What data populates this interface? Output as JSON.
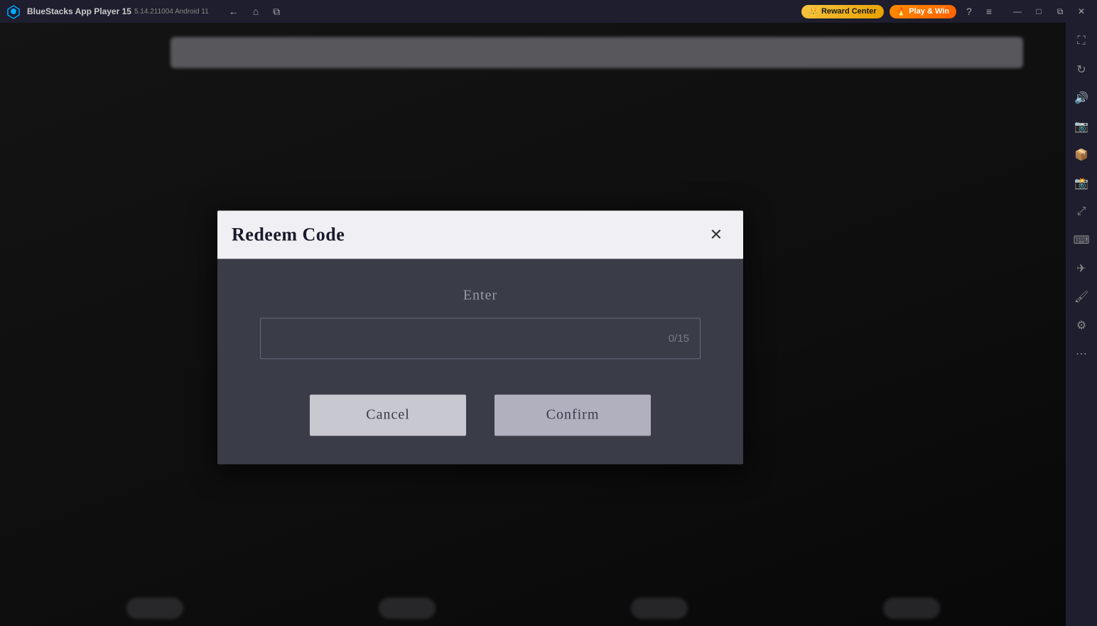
{
  "titlebar": {
    "app_name": "BlueStacks App Player 15",
    "version": "5.14.211004  Android 11",
    "reward_center_label": "Reward Center",
    "play_win_label": "Play & Win",
    "nav": {
      "back_label": "←",
      "home_label": "⌂",
      "copy_label": "❐"
    },
    "window_controls": {
      "minimize": "—",
      "maximize": "□",
      "close": "✕",
      "restore": "⧉"
    },
    "help_label": "?",
    "menu_label": "≡"
  },
  "sidebar": {
    "icons": [
      "fullscreen-icon",
      "screen-rotate-icon",
      "volume-icon",
      "camera-icon",
      "apk-icon",
      "screenshot-icon",
      "expand-icon",
      "keyboard-icon",
      "airplane-icon",
      "brush-icon",
      "settings-icon",
      "more-icon"
    ]
  },
  "dialog": {
    "title": "Redeem Code",
    "close_label": "✕",
    "enter_label": "Enter",
    "input_placeholder": "",
    "counter": "0/15",
    "cancel_label": "Cancel",
    "confirm_label": "Confirm"
  }
}
